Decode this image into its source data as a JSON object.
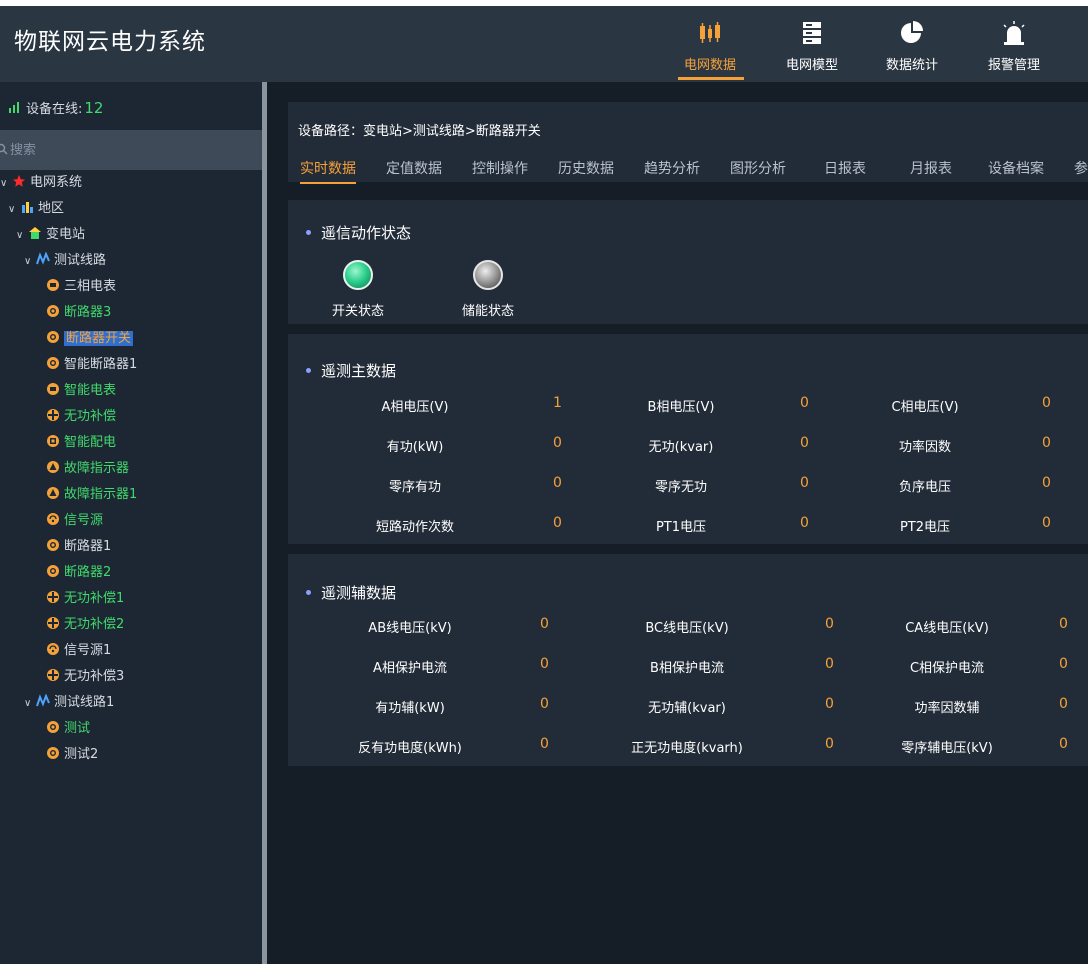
{
  "app": {
    "title": "物联网云电力系统"
  },
  "nav": [
    {
      "label": "电网数据",
      "icon": "candlestick-icon",
      "active": true
    },
    {
      "label": "电网模型",
      "icon": "server-icon",
      "active": false
    },
    {
      "label": "数据统计",
      "icon": "pie-chart-icon",
      "active": false
    },
    {
      "label": "报警管理",
      "icon": "alarm-light-icon",
      "active": false
    }
  ],
  "sidebar": {
    "online_label": "设备在线:",
    "online_count": "12",
    "search_placeholder": "搜索",
    "tree": [
      {
        "label": "电网系统",
        "icon": "star-icon",
        "color": "white",
        "caret": "v"
      },
      {
        "label": "地区",
        "icon": "region-icon",
        "color": "white",
        "caret": "v"
      },
      {
        "label": "变电站",
        "icon": "substation-icon",
        "color": "white",
        "caret": "v"
      },
      {
        "label": "测试线路",
        "icon": "line-icon",
        "color": "white",
        "caret": "v"
      },
      {
        "label": "三相电表",
        "icon": "meter-icon",
        "color": "white"
      },
      {
        "label": "断路器3",
        "icon": "breaker-icon",
        "color": "green"
      },
      {
        "label": "断路器开关",
        "icon": "breaker-icon",
        "color": "selected"
      },
      {
        "label": "智能断路器1",
        "icon": "breaker-icon",
        "color": "white"
      },
      {
        "label": "智能电表",
        "icon": "meter-icon",
        "color": "green"
      },
      {
        "label": "无功补偿",
        "icon": "compensator-icon",
        "color": "green"
      },
      {
        "label": "智能配电",
        "icon": "distribution-icon",
        "color": "green"
      },
      {
        "label": "故障指示器",
        "icon": "fault-indicator-icon",
        "color": "green"
      },
      {
        "label": "故障指示器1",
        "icon": "fault-indicator-icon",
        "color": "green"
      },
      {
        "label": "信号源",
        "icon": "signal-source-icon",
        "color": "green"
      },
      {
        "label": "断路器1",
        "icon": "breaker-icon",
        "color": "white"
      },
      {
        "label": "断路器2",
        "icon": "breaker-icon",
        "color": "green"
      },
      {
        "label": "无功补偿1",
        "icon": "compensator-icon",
        "color": "green"
      },
      {
        "label": "无功补偿2",
        "icon": "compensator-icon",
        "color": "green"
      },
      {
        "label": "信号源1",
        "icon": "signal-source-icon",
        "color": "white"
      },
      {
        "label": "无功补偿3",
        "icon": "compensator-icon",
        "color": "white"
      },
      {
        "label": "测试线路1",
        "icon": "line-icon",
        "color": "white",
        "caret": "v"
      },
      {
        "label": "测试",
        "icon": "breaker-icon",
        "color": "green"
      },
      {
        "label": "测试2",
        "icon": "breaker-icon",
        "color": "white"
      }
    ]
  },
  "main": {
    "path_label": "设备路径：",
    "path_value": "变电站>测试线路>断路器开关",
    "tabs": [
      {
        "label": "实时数据",
        "active": true
      },
      {
        "label": "定值数据"
      },
      {
        "label": "控制操作"
      },
      {
        "label": "历史数据"
      },
      {
        "label": "趋势分析"
      },
      {
        "label": "图形分析"
      },
      {
        "label": "日报表"
      },
      {
        "label": "月报表"
      },
      {
        "label": "设备档案"
      },
      {
        "label": "参"
      }
    ],
    "signal_section": {
      "title": "遥信动作状态",
      "indicators": [
        {
          "label": "开关状态",
          "state": "green"
        },
        {
          "label": "储能状态",
          "state": "gray"
        }
      ]
    },
    "main_data": {
      "title": "遥测主数据",
      "rows": [
        [
          {
            "label": "A相电压(V)",
            "value": "1"
          },
          {
            "label": "B相电压(V)",
            "value": "0"
          },
          {
            "label": "C相电压(V)",
            "value": "0"
          }
        ],
        [
          {
            "label": "有功(kW)",
            "value": "0"
          },
          {
            "label": "无功(kvar)",
            "value": "0"
          },
          {
            "label": "功率因数",
            "value": "0"
          }
        ],
        [
          {
            "label": "零序有功",
            "value": "0"
          },
          {
            "label": "零序无功",
            "value": "0"
          },
          {
            "label": "负序电压",
            "value": "0"
          }
        ],
        [
          {
            "label": "短路动作次数",
            "value": "0"
          },
          {
            "label": "PT1电压",
            "value": "0"
          },
          {
            "label": "PT2电压",
            "value": "0"
          }
        ]
      ]
    },
    "aux_data": {
      "title": "遥测辅数据",
      "rows": [
        [
          {
            "label": "AB线电压(kV)",
            "value": "0"
          },
          {
            "label": "BC线电压(kV)",
            "value": "0"
          },
          {
            "label": "CA线电压(kV)",
            "value": "0"
          }
        ],
        [
          {
            "label": "A相保护电流",
            "value": "0"
          },
          {
            "label": "B相保护电流",
            "value": "0"
          },
          {
            "label": "C相保护电流",
            "value": "0"
          }
        ],
        [
          {
            "label": "有功辅(kW)",
            "value": "0"
          },
          {
            "label": "无功辅(kvar)",
            "value": "0"
          },
          {
            "label": "功率因数辅",
            "value": "0"
          }
        ],
        [
          {
            "label": "反有功电度(kWh)",
            "value": "0"
          },
          {
            "label": "正无功电度(kvarh)",
            "value": "0"
          },
          {
            "label": "零序辅电压(kV)",
            "value": "0"
          }
        ]
      ]
    }
  },
  "colors": {
    "accent": "#f5a13a",
    "online_green": "#41d96c",
    "header_bg": "#2b3643",
    "panel_bg": "#222c38"
  }
}
